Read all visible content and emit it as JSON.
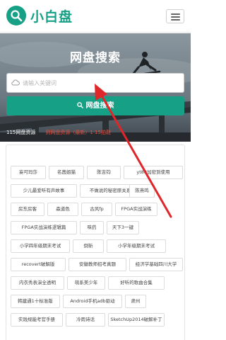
{
  "header": {
    "brand": "小白盘",
    "logo_icon": "search-icon",
    "menu_icon": "hamburger-icon"
  },
  "hero": {
    "title": "网盘搜索",
    "search_placeholder": "请输入关键词",
    "search_button_label": "网盘搜索",
    "stats_left": "115网盘资源",
    "stats_right": "到网盘资源（最新）1 15拍鞋"
  },
  "tags": [
    "妄可玛莎",
    "名茜姐猫",
    "陈吉钧",
    "yt88加密到使用",
    "少儿最爱听有声故事",
    "不做说的秘密原关系",
    "陈燕鸣",
    "房东房客",
    "森道色",
    "古风fp",
    "FPGA实战演练",
    "FPGA实战演练逻辑篇",
    "味药",
    "天下3一键",
    "小学四年级期末考试",
    "倒斩",
    "小学年级期末考试",
    "recovert破解版",
    "安徽教师招考真题",
    "经济学基础四川大学",
    "内衣秀表演全透明",
    "萌系美少年",
    "好听的歌曲合集",
    "韩建通1十标准版",
    "Android手机adb驱动",
    "肃州",
    "实践规能考官手册",
    "冷雨诗话",
    "SketchUp2014破解补丁"
  ],
  "colors": {
    "accent": "#16a085",
    "annotation_arrow": "#e0262b",
    "stats_highlight": "#e74c3c"
  }
}
